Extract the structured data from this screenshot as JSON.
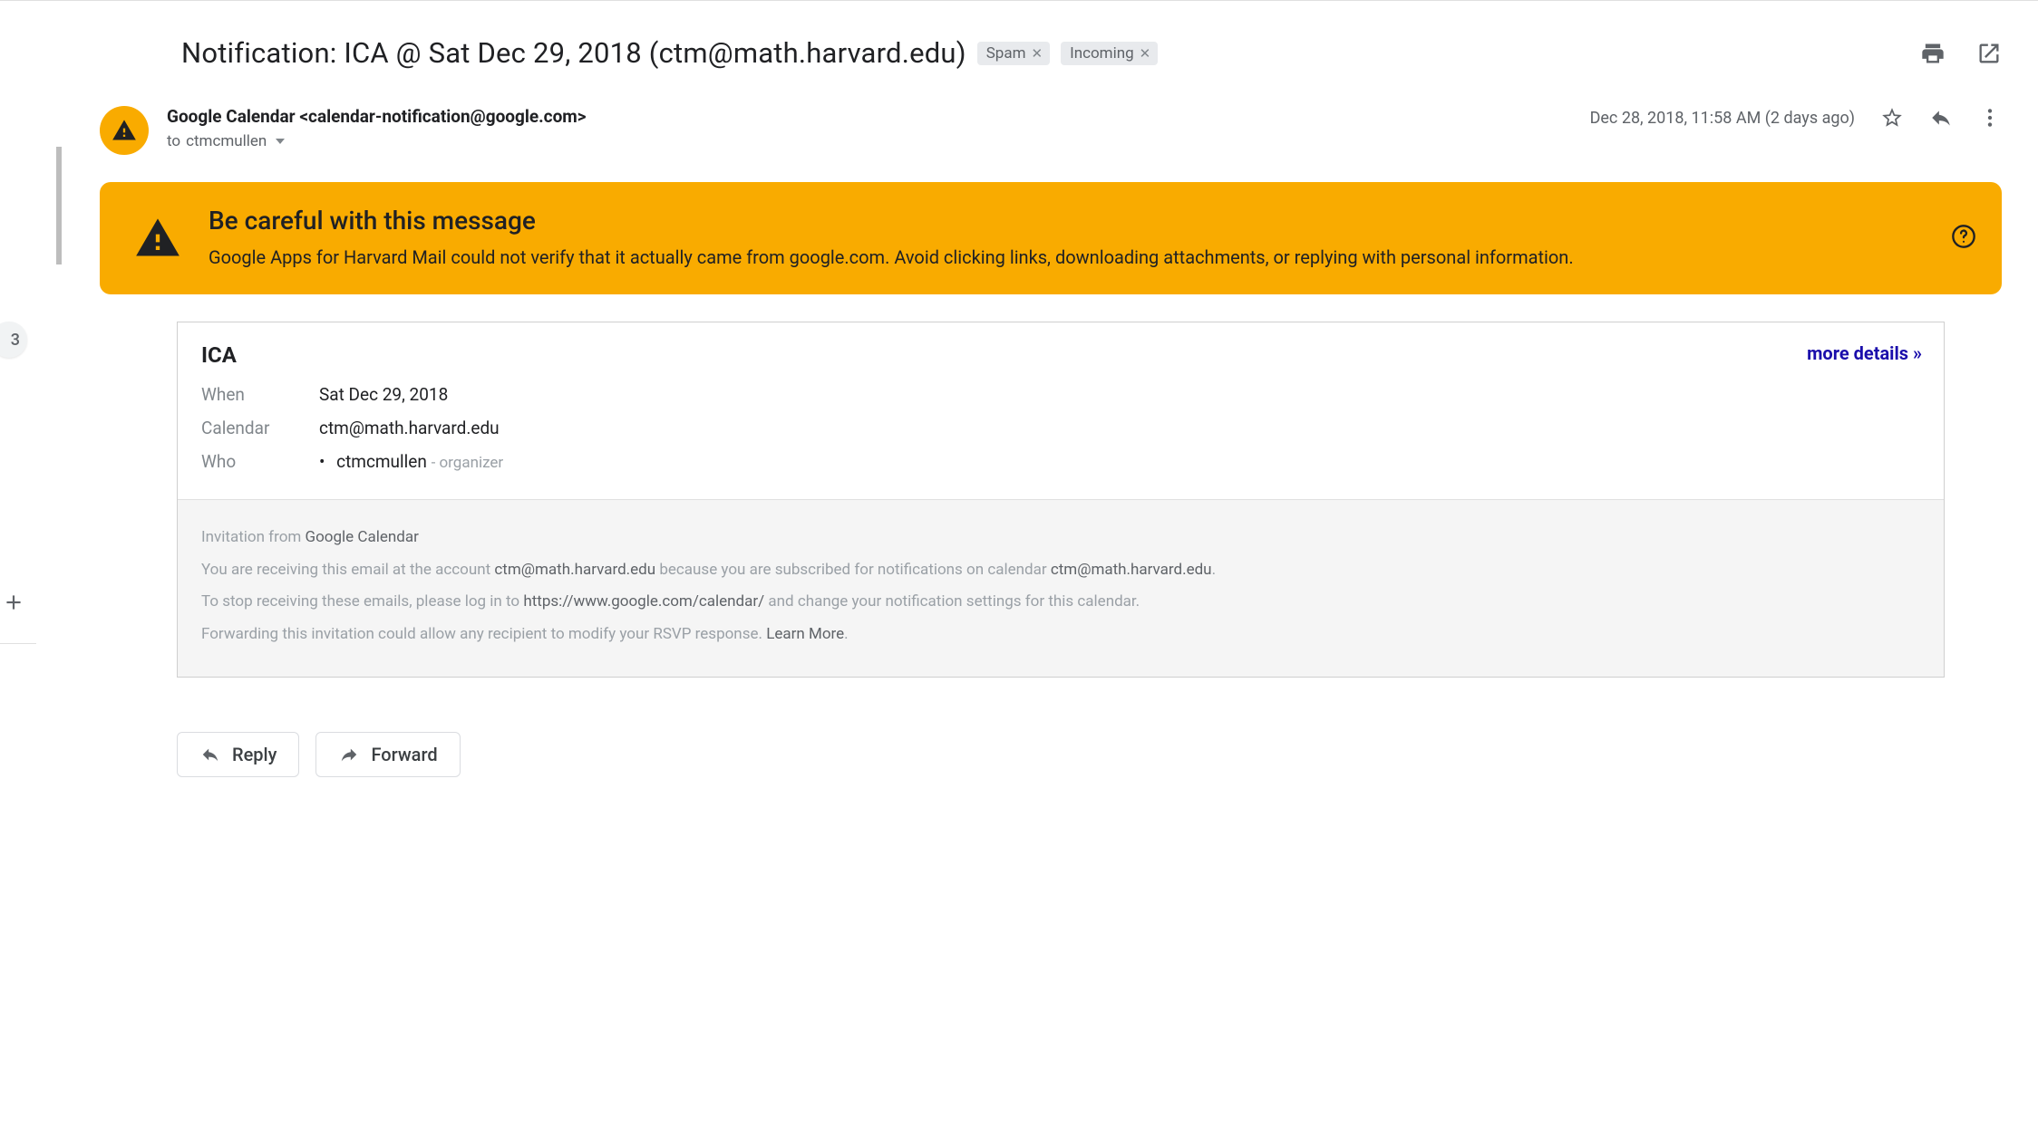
{
  "left": {
    "count": "3"
  },
  "header": {
    "subject": "Notification: ICA @ Sat Dec 29, 2018 (ctm@math.harvard.edu)",
    "labels": [
      {
        "name": "Spam"
      },
      {
        "name": "Incoming"
      }
    ]
  },
  "sender": {
    "name": "Google Calendar",
    "email": "<calendar-notification@google.com>",
    "to_prefix": "to",
    "to": "ctmcmullen",
    "date": "Dec 28, 2018, 11:58 AM (2 days ago)"
  },
  "warning": {
    "title": "Be careful with this message",
    "body": "Google Apps for Harvard Mail could not verify that it actually came from google.com. Avoid clicking links, downloading attachments, or replying with personal information."
  },
  "event": {
    "title": "ICA",
    "more_details": "more details »",
    "labels": {
      "when": "When",
      "calendar": "Calendar",
      "who": "Who"
    },
    "when": "Sat Dec 29, 2018",
    "calendar": "ctm@math.harvard.edu",
    "who_name": "ctmcmullen",
    "who_role": "- organizer"
  },
  "footer": {
    "p1_a": "Invitation from ",
    "p1_b": "Google Calendar",
    "p2_a": "You are receiving this email at the account ",
    "p2_b": "ctm@math.harvard.edu",
    "p2_c": " because you are subscribed for notifications on calendar ",
    "p2_d": "ctm@math.harvard.edu",
    "p2_e": ".",
    "p3_a": "To stop receiving these emails, please log in to ",
    "p3_b": "https://www.google.com/calendar/",
    "p3_c": " and change your notification settings for this calendar.",
    "p4_a": "Forwarding this invitation could allow any recipient to modify your RSVP response. ",
    "p4_b": "Learn More",
    "p4_c": "."
  },
  "actions": {
    "reply": "Reply",
    "forward": "Forward"
  }
}
